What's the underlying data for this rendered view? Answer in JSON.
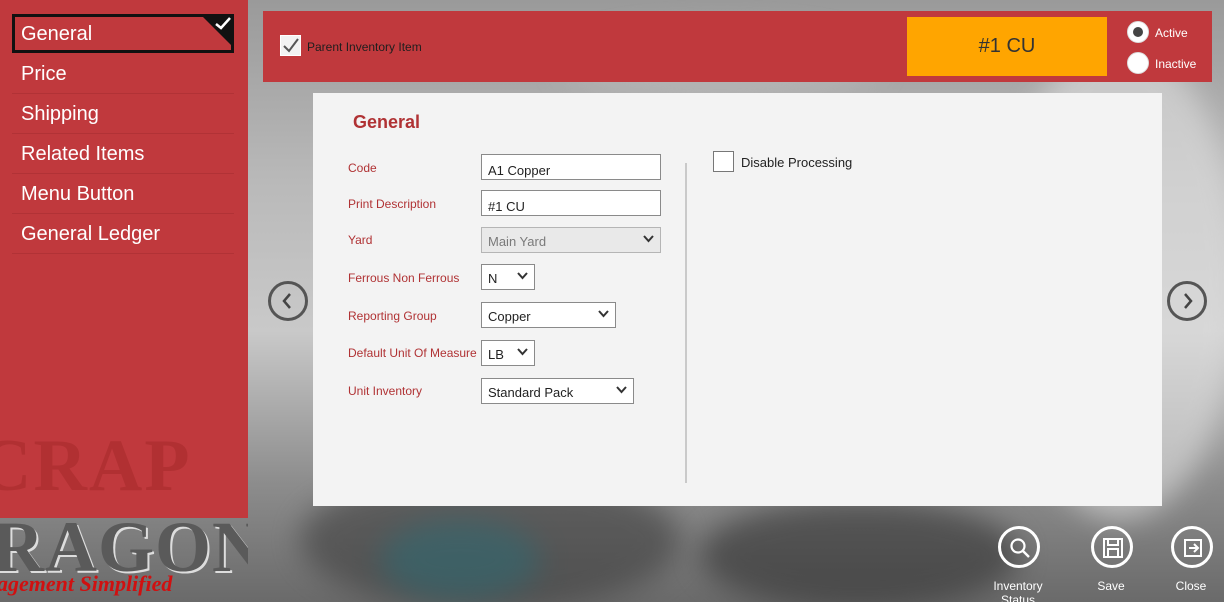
{
  "sidebar": {
    "items": [
      {
        "label": "General",
        "selected": true
      },
      {
        "label": "Price"
      },
      {
        "label": "Shipping"
      },
      {
        "label": "Related Items"
      },
      {
        "label": "Menu Button"
      },
      {
        "label": "General Ledger"
      }
    ]
  },
  "logo": {
    "word1": "CRAP",
    "word2": "RAGON",
    "tagline": "agement Simplified"
  },
  "header": {
    "parent_checkbox_label": "Parent Inventory Item",
    "parent_checked": true,
    "badge_text": "#1 CU",
    "badge_color": "#ffa500",
    "status_options": [
      {
        "label": "Active",
        "checked": true
      },
      {
        "label": "Inactive",
        "checked": false
      }
    ]
  },
  "general": {
    "title": "General",
    "fields": {
      "code": {
        "label": "Code",
        "value": "A1 Copper"
      },
      "print_description": {
        "label": "Print Description",
        "value": "#1 CU"
      },
      "yard": {
        "label": "Yard",
        "value": "Main Yard",
        "disabled": true
      },
      "ferrous": {
        "label": "Ferrous Non Ferrous",
        "value": "N"
      },
      "reporting_group": {
        "label": "Reporting Group",
        "value": "Copper"
      },
      "uom": {
        "label": "Default Unit Of Measure",
        "value": "LB"
      },
      "unit_inventory": {
        "label": "Unit Inventory",
        "value": "Standard Pack"
      }
    },
    "disable_processing": {
      "label": "Disable Processing",
      "checked": false
    }
  },
  "toolbar": {
    "inventory_status": "Inventory Status",
    "save": "Save",
    "close": "Close"
  },
  "colors": {
    "accent_red": "#c0393d",
    "label_red": "#b03234"
  }
}
